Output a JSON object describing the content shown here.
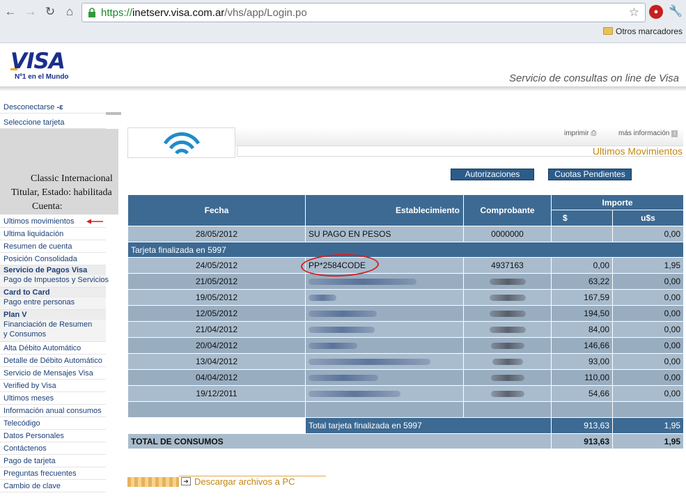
{
  "browser": {
    "url_scheme": "https://",
    "url_host": "inetserv.visa.com.ar",
    "url_path": "/vhs/app/Login.po",
    "bookmark_folder": "Otros marcadores"
  },
  "header": {
    "logo_text": "VISA",
    "logo_tagline": "Nº1 en el Mundo",
    "service_title": "Servicio de consultas on line de Visa"
  },
  "sidebar": {
    "top_items": [
      "Desconectarse",
      "Seleccione tarjeta"
    ],
    "card": {
      "product": "Classic Internacional",
      "holder_status": "Titular, Estado: habilitada",
      "account_label": "Cuenta:"
    },
    "items": [
      "Ultimos movimientos",
      "Ultima liquidación",
      "Resumen de cuenta",
      "Posición Consolidada"
    ],
    "groups": [
      {
        "title": "Servicio de Pagos Visa",
        "subs": [
          "Pago de Impuestos y Servicios"
        ]
      },
      {
        "title": "Card to Card",
        "subs": [
          "Pago entre personas"
        ]
      },
      {
        "title": "Plan V",
        "subs": [
          "Financiación de Resumen",
          "y Consumos"
        ]
      }
    ],
    "more_items": [
      "Alta Débito Automático",
      "Detalle de Débito Automático",
      "Servicio de Mensajes Visa",
      "Verified by Visa",
      "Ultimos meses",
      "Información anual consumos",
      "Telecódigo",
      "Datos Personales",
      "Contáctenos",
      "Pago de tarjeta",
      "Preguntas frecuentes",
      "Cambio de clave"
    ]
  },
  "main": {
    "print_label": "imprimir",
    "more_info_label": "más información",
    "page_title": "Ultimos Movimientos",
    "buttons": {
      "authorizations": "Autorizaciones",
      "installments": "Cuotas Pendientes"
    },
    "table": {
      "headers": {
        "fecha": "Fecha",
        "establecimiento": "Establecimiento",
        "comprobante": "Comprobante",
        "importe": "Importe",
        "pesos": "$",
        "dolares": "u$s"
      },
      "first_row": {
        "fecha": "28/05/2012",
        "establecimiento": "SU PAGO EN PESOS",
        "comprobante": "0000000",
        "pesos": "",
        "dolares": "0,00"
      },
      "section_label": "Tarjeta finalizada en 5997",
      "rows": [
        {
          "fecha": "24/05/2012",
          "establecimiento": "PP*2584CODE",
          "comprobante": "4937163",
          "pesos": "0,00",
          "dolares": "1,95"
        },
        {
          "fecha": "21/05/2012",
          "establecimiento": "",
          "comprobante": "",
          "pesos": "63,22",
          "dolares": "0,00"
        },
        {
          "fecha": "19/05/2012",
          "establecimiento": "",
          "comprobante": "",
          "pesos": "167,59",
          "dolares": "0,00"
        },
        {
          "fecha": "12/05/2012",
          "establecimiento": "",
          "comprobante": "",
          "pesos": "194,50",
          "dolares": "0,00"
        },
        {
          "fecha": "21/04/2012",
          "establecimiento": "",
          "comprobante": "",
          "pesos": "84,00",
          "dolares": "0,00"
        },
        {
          "fecha": "20/04/2012",
          "establecimiento": "",
          "comprobante": "",
          "pesos": "146,66",
          "dolares": "0,00"
        },
        {
          "fecha": "13/04/2012",
          "establecimiento": "",
          "comprobante": "",
          "pesos": "93,00",
          "dolares": "0,00"
        },
        {
          "fecha": "04/04/2012",
          "establecimiento": "",
          "comprobante": "",
          "pesos": "110,00",
          "dolares": "0,00"
        },
        {
          "fecha": "19/12/2011",
          "establecimiento": "",
          "comprobante": "",
          "pesos": "54,66",
          "dolares": "0,00"
        }
      ],
      "card_total": {
        "label": "Total tarjeta finalizada en 5997",
        "pesos": "913,63",
        "dolares": "1,95"
      },
      "grand_total": {
        "label": "TOTAL DE CONSUMOS",
        "pesos": "913,63",
        "dolares": "1,95"
      }
    },
    "download_label": "Descargar archivos a PC"
  }
}
